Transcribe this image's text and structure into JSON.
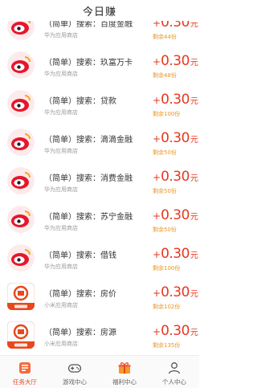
{
  "header": {
    "title": "今日赚"
  },
  "tasks": [
    {
      "title": "（简单）搜索：百度金融",
      "source": "华为应用商店",
      "reward_plus": "+",
      "reward_amount": "0.30",
      "reward_unit": "元",
      "remaining": "剩余44份",
      "icon": "weibo-icon"
    },
    {
      "title": "（简单）搜索：玖富万卡",
      "source": "华为应用商店",
      "reward_plus": "+",
      "reward_amount": "0.30",
      "reward_unit": "元",
      "remaining": "剩余48份",
      "icon": "weibo-icon"
    },
    {
      "title": "（简单）搜索：贷款",
      "source": "华为应用商店",
      "reward_plus": "+",
      "reward_amount": "0.30",
      "reward_unit": "元",
      "remaining": "剩余100份",
      "icon": "weibo-icon"
    },
    {
      "title": "（简单）搜索：滴滴金融",
      "source": "华为应用商店",
      "reward_plus": "+",
      "reward_amount": "0.30",
      "reward_unit": "元",
      "remaining": "剩余50份",
      "icon": "weibo-icon"
    },
    {
      "title": "（简单）搜索：消费金融",
      "source": "华为应用商店",
      "reward_plus": "+",
      "reward_amount": "0.30",
      "reward_unit": "元",
      "remaining": "剩余50份",
      "icon": "weibo-icon"
    },
    {
      "title": "（简单）搜索：苏宁金融",
      "source": "华为应用商店",
      "reward_plus": "+",
      "reward_amount": "0.30",
      "reward_unit": "元",
      "remaining": "剩余50份",
      "icon": "weibo-icon"
    },
    {
      "title": "（简单）搜索：借钱",
      "source": "华为应用商店",
      "reward_plus": "+",
      "reward_amount": "0.30",
      "reward_unit": "元",
      "remaining": "剩余100份",
      "icon": "weibo-icon"
    },
    {
      "title": "（简单）搜索：房价",
      "source": "小米应用商店",
      "reward_plus": "+",
      "reward_amount": "0.30",
      "reward_unit": "元",
      "remaining": "剩余102份",
      "icon": "zhongyuan-app-icon"
    },
    {
      "title": "（简单）搜索：房源",
      "source": "小米应用商店",
      "reward_plus": "+",
      "reward_amount": "0.30",
      "reward_unit": "元",
      "remaining": "剩余135份",
      "icon": "zhongyuan-app-icon"
    }
  ],
  "tabbar": {
    "tabs": [
      {
        "label": "任务大厅",
        "icon": "task-hall-icon",
        "active": true
      },
      {
        "label": "游戏中心",
        "icon": "gamepad-icon",
        "active": false
      },
      {
        "label": "福利中心",
        "icon": "gift-icon",
        "active": false
      },
      {
        "label": "个人中心",
        "icon": "person-icon",
        "active": false
      }
    ]
  },
  "colors": {
    "reward": "#e9361f",
    "remaining": "#e9961f",
    "active_tab": "#e94323"
  }
}
